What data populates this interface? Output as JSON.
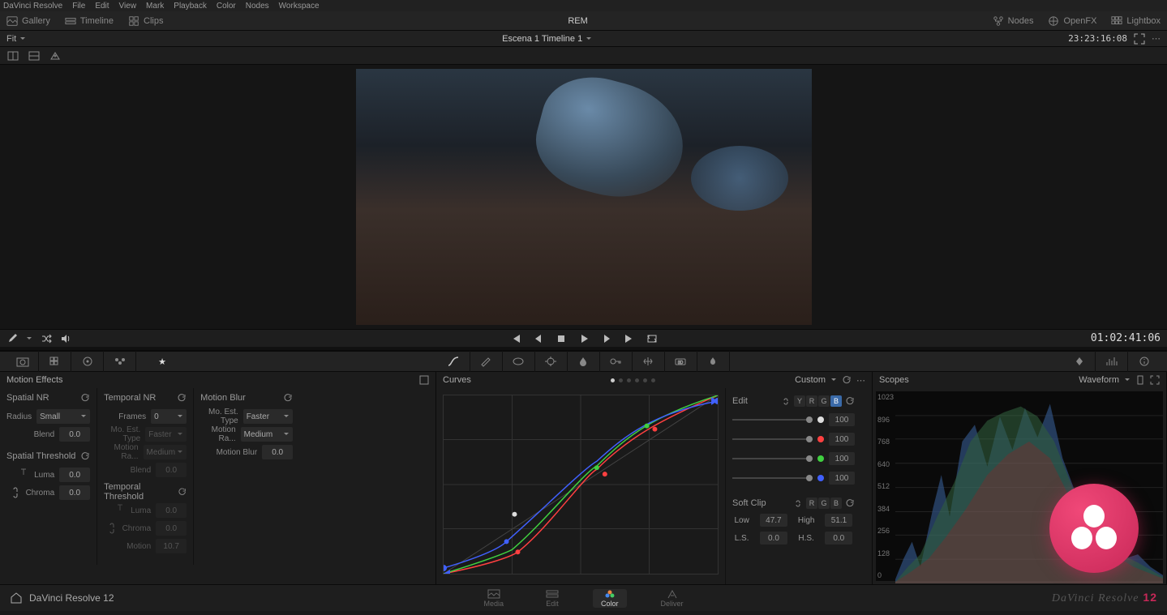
{
  "menubar": [
    "DaVinci Resolve",
    "File",
    "Edit",
    "View",
    "Mark",
    "Playback",
    "Color",
    "Nodes",
    "Workspace"
  ],
  "topbar": {
    "left": [
      {
        "icon": "gallery-icon",
        "label": "Gallery"
      },
      {
        "icon": "timeline-icon",
        "label": "Timeline"
      },
      {
        "icon": "clips-icon",
        "label": "Clips"
      }
    ],
    "center": "REM",
    "right": [
      {
        "icon": "nodes-icon",
        "label": "Nodes"
      },
      {
        "icon": "openfx-icon",
        "label": "OpenFX"
      },
      {
        "icon": "lightbox-icon",
        "label": "Lightbox"
      }
    ]
  },
  "fitbar": {
    "fit_label": "Fit",
    "timeline_label": "Escena 1 Timeline 1",
    "timecode": "23:23:16:08"
  },
  "transport": {
    "timecode": "01:02:41:06"
  },
  "motion_effects": {
    "title": "Motion Effects",
    "spatial_nr": {
      "title": "Spatial NR",
      "radius": {
        "label": "Radius",
        "value": "Small"
      },
      "blend": {
        "label": "Blend",
        "value": "0.0"
      }
    },
    "spatial_threshold": {
      "title": "Spatial Threshold",
      "luma": {
        "label": "Luma",
        "value": "0.0"
      },
      "chroma": {
        "label": "Chroma",
        "value": "0.0"
      }
    },
    "temporal_nr": {
      "title": "Temporal NR",
      "frames": {
        "label": "Frames",
        "value": "0"
      },
      "mo_est_type": {
        "label": "Mo. Est. Type",
        "value": "Faster"
      },
      "motion_range": {
        "label": "Motion Ra...",
        "value": "Medium"
      },
      "blend": {
        "label": "Blend",
        "value": "0.0"
      }
    },
    "temporal_threshold": {
      "title": "Temporal Threshold",
      "luma": {
        "label": "Luma",
        "value": "0.0"
      },
      "chroma": {
        "label": "Chroma",
        "value": "0.0"
      },
      "motion": {
        "label": "Motion",
        "value": "10.7"
      }
    },
    "motion_blur": {
      "title": "Motion Blur",
      "mo_est_type": {
        "label": "Mo. Est. Type",
        "value": "Faster"
      },
      "motion_range": {
        "label": "Motion Ra...",
        "value": "Medium"
      },
      "motion_blur": {
        "label": "Motion Blur",
        "value": "0.0"
      }
    }
  },
  "curves": {
    "title": "Curves",
    "mode": "Custom",
    "edit_label": "Edit",
    "channels": [
      "Y",
      "R",
      "G",
      "B"
    ],
    "active_channel": "B",
    "intensity": [
      {
        "color": "#ddd",
        "value": "100"
      },
      {
        "color": "#ff4040",
        "value": "100"
      },
      {
        "color": "#40d040",
        "value": "100"
      },
      {
        "color": "#4060ff",
        "value": "100"
      }
    ],
    "softclip": {
      "title": "Soft Clip",
      "channels": [
        "R",
        "G",
        "B"
      ],
      "low": {
        "label": "Low",
        "value": "47.7"
      },
      "high": {
        "label": "High",
        "value": "51.1"
      },
      "ls": {
        "label": "L.S.",
        "value": "0.0"
      },
      "hs": {
        "label": "H.S.",
        "value": "0.0"
      }
    }
  },
  "scopes": {
    "title": "Scopes",
    "mode": "Waveform",
    "labels": [
      "1023",
      "896",
      "768",
      "640",
      "512",
      "384",
      "256",
      "128",
      "0"
    ]
  },
  "bottombar": {
    "app": "DaVinci Resolve 12",
    "tabs": [
      "Media",
      "Edit",
      "Color",
      "Deliver"
    ],
    "active_tab": "Color",
    "brand": "DaVinci Resolve 12"
  },
  "chart_data": {
    "type": "line",
    "title": "Curves",
    "xlim": [
      0,
      1
    ],
    "ylim": [
      0,
      1
    ],
    "series": [
      {
        "name": "B (blue)",
        "color": "#4060ff",
        "points": [
          [
            0.0,
            0.03
          ],
          [
            0.23,
            0.18
          ],
          [
            0.55,
            0.6
          ],
          [
            0.74,
            0.83
          ],
          [
            1.0,
            0.97
          ]
        ]
      },
      {
        "name": "G (green)",
        "color": "#40d040",
        "points": [
          [
            0.0,
            0.0
          ],
          [
            0.25,
            0.14
          ],
          [
            0.56,
            0.58
          ],
          [
            0.77,
            0.86
          ],
          [
            1.0,
            1.0
          ]
        ]
      },
      {
        "name": "R (red)",
        "color": "#ff4040",
        "points": [
          [
            0.0,
            0.0
          ],
          [
            0.27,
            0.12
          ],
          [
            0.6,
            0.55
          ],
          [
            0.79,
            0.82
          ],
          [
            1.0,
            1.0
          ]
        ]
      }
    ]
  }
}
